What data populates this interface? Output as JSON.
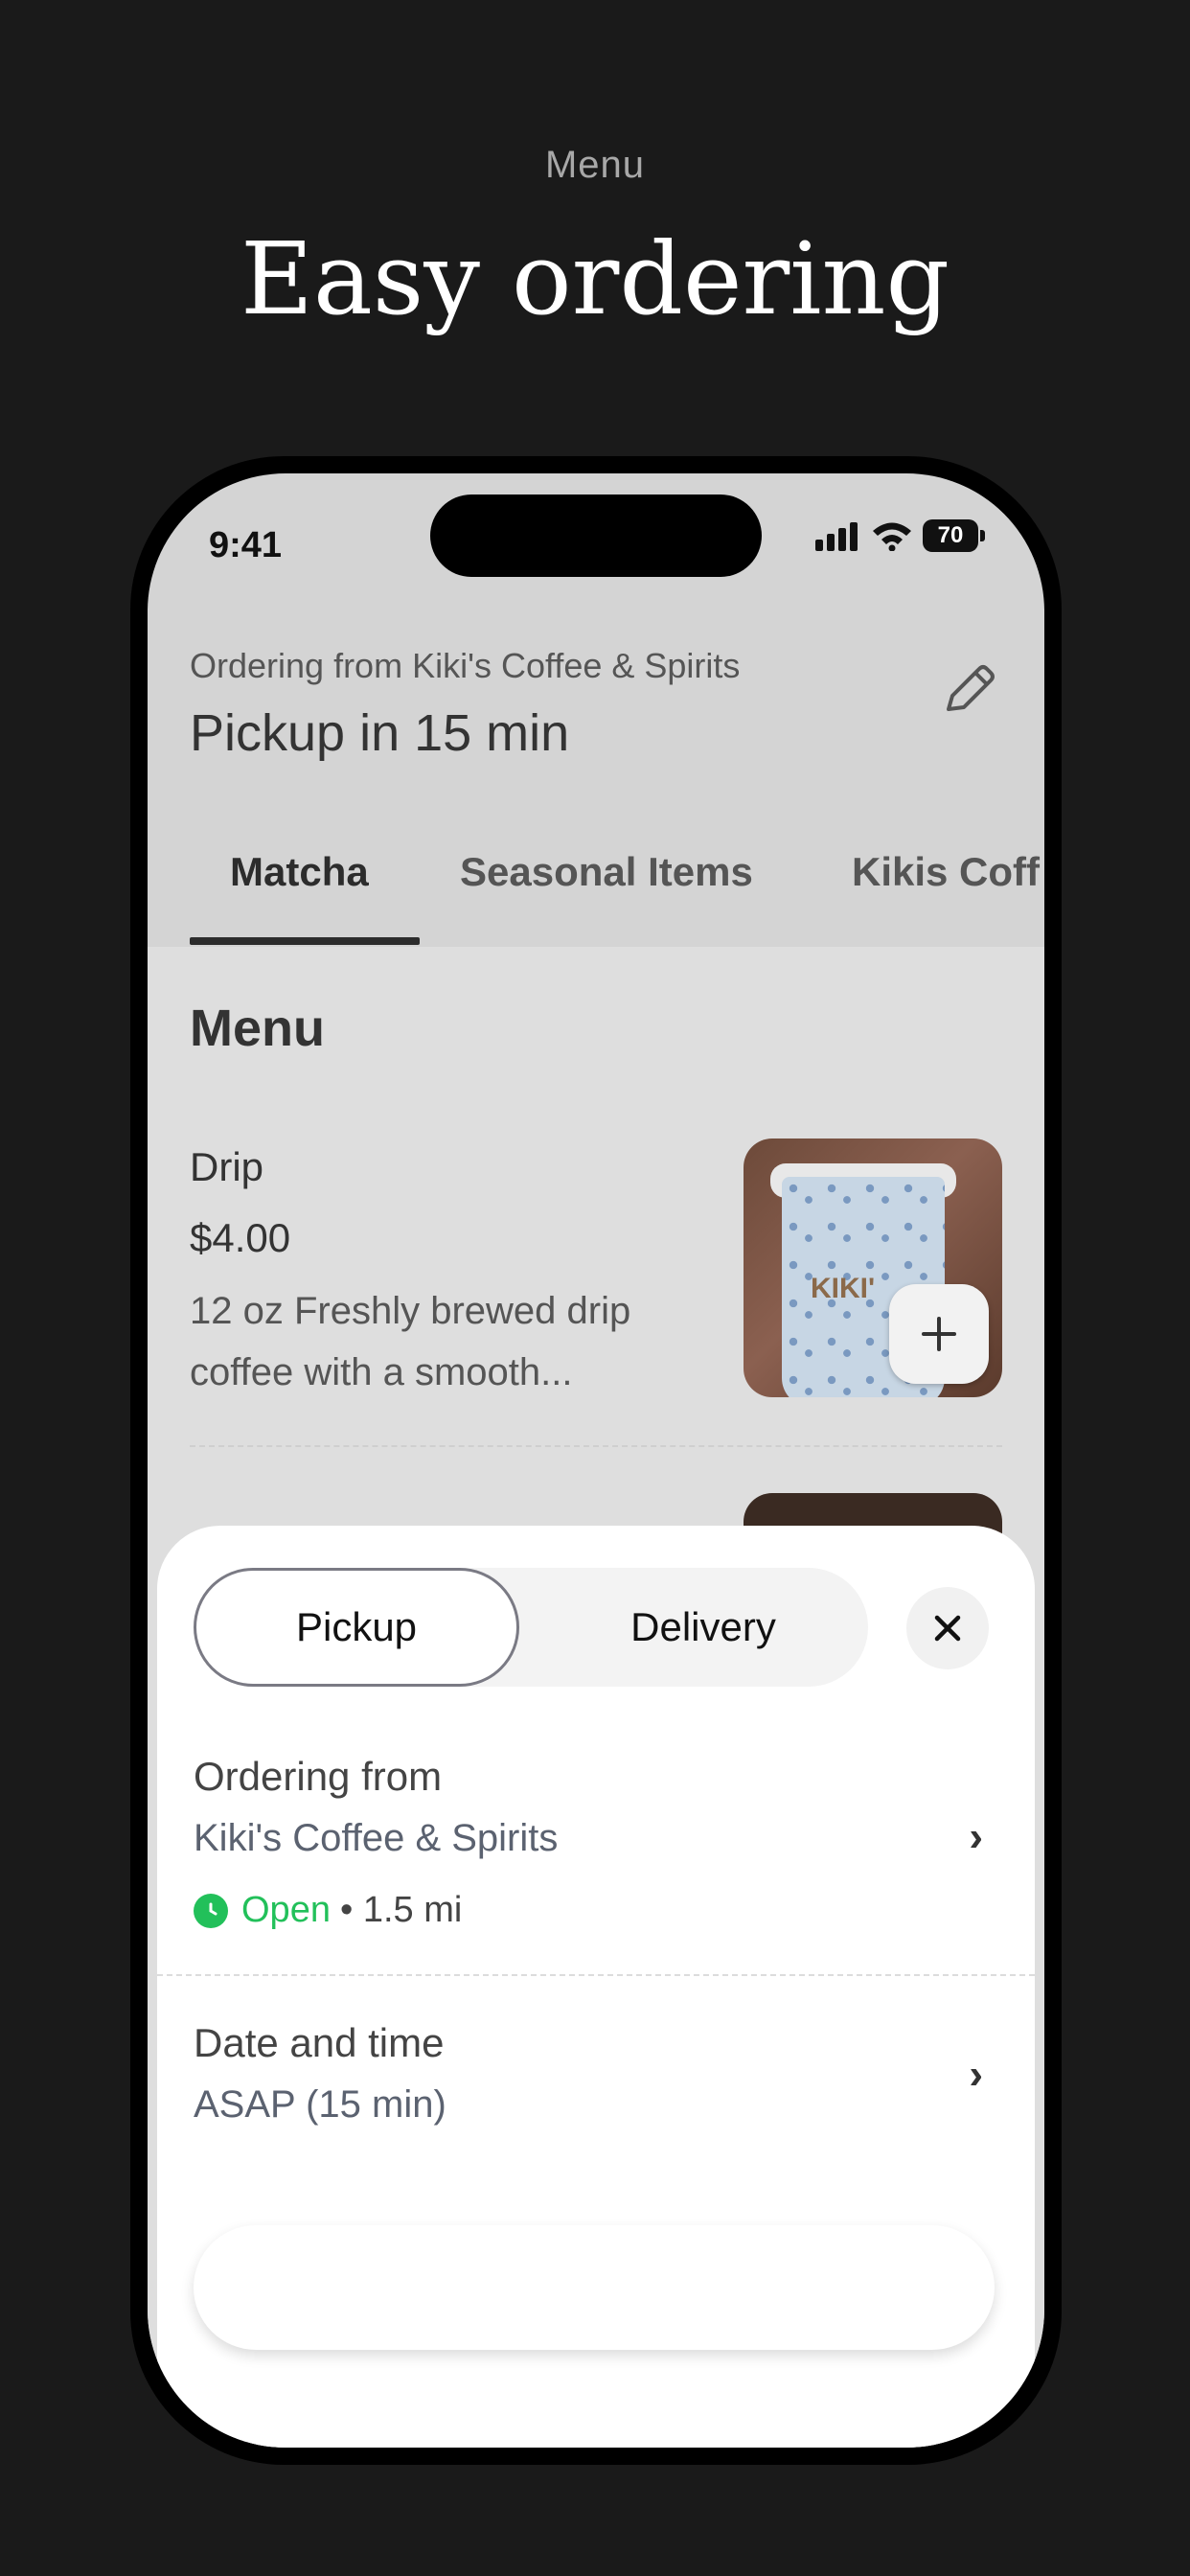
{
  "page": {
    "caption": "Menu",
    "headline": "Easy ordering"
  },
  "status_bar": {
    "time": "9:41",
    "battery": "70"
  },
  "header": {
    "ordering_from": "Ordering from Kiki's Coffee & Spirits",
    "pickup_title": "Pickup in 15 min"
  },
  "tabs": [
    {
      "label": "Matcha",
      "active": true
    },
    {
      "label": "Seasonal Items",
      "active": false
    },
    {
      "label": "Kikis Coff",
      "active": false
    }
  ],
  "menu": {
    "title": "Menu",
    "items": [
      {
        "name": "Drip",
        "price": "$4.00",
        "description": "12 oz Freshly brewed drip coffee with a smooth...",
        "image_text": "KIKI'"
      }
    ]
  },
  "sheet": {
    "segments": {
      "pickup": "Pickup",
      "delivery": "Delivery",
      "selected": "Pickup"
    },
    "ordering_from_label": "Ordering from",
    "store_name": "Kiki's Coffee & Spirits",
    "open_status": "Open",
    "distance": "• 1.5 mi",
    "date_time_label": "Date and time",
    "date_time_value": "ASAP (15 min)"
  },
  "colors": {
    "background": "#1a1a1a",
    "open_green": "#22c05a"
  }
}
